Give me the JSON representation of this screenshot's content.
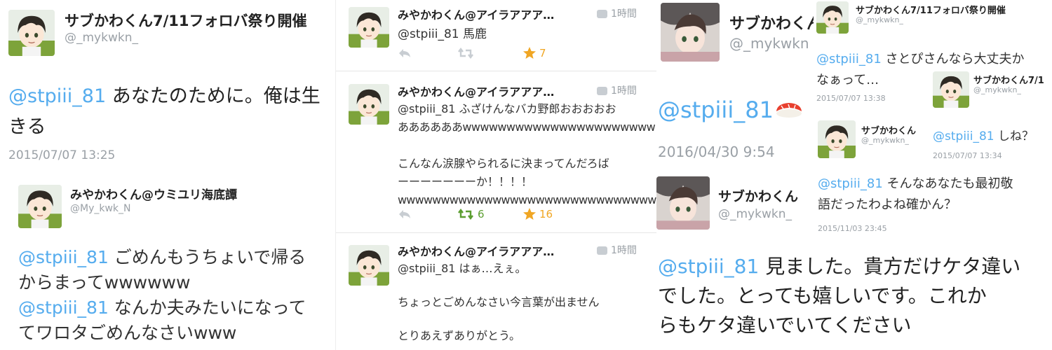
{
  "panel1": {
    "header": {
      "display_name": "サブかわくん7/11フォロバ祭り開催",
      "handle": "@_mykwkn_"
    },
    "tweet": {
      "mention": "@stpiii_81",
      "text_line1": " あなたのために。俺は生",
      "text_line2": "きる",
      "timestamp": "2015/07/07 13:25"
    },
    "reply": {
      "display_name": "みやかわくん@ウミユリ海底譚",
      "handle": "@My_kwk_N",
      "line1_mention": "@stpiii_81",
      "line1_text": " ごめんもうちょいで帰る",
      "line2": "からまってwwwwww",
      "line3_mention": "@stpiii_81",
      "line3_text": " なんか夫みたいになって",
      "line4": "てワロタごめんなさいwww"
    }
  },
  "panel2": {
    "tweets": [
      {
        "name": "みやかわくん@アイラアアア…",
        "time": "1時間",
        "mention": "@stpiii_81",
        "text": " 馬鹿",
        "retweets": "",
        "favorites": "7"
      },
      {
        "name": "みやかわくん@アイラアアア…",
        "time": "1時間",
        "mention": "@stpiii_81",
        "text_line1": " ふざけんなバカ野郎おおおおお",
        "text_line2": "ああああああwwwwwwwwwwwwwwwwwwwwww",
        "text_line3": "こんなん涙腺やられるに決まってんだろば",
        "text_line4": "ーーーーーーーか！！！！",
        "text_line5": "wwwwwwwwwwwwwwwwwwwwwwwwwwwwww",
        "retweets": "6",
        "favorites": "16"
      },
      {
        "name": "みやかわくん@アイラアアア…",
        "time": "1時間",
        "mention": "@stpiii_81",
        "text_line1": " はぁ…えぇ。",
        "text_line2": "ちょっとごめんなさい今言葉が出ません",
        "text_line3": "とりあえずありがとう。"
      }
    ]
  },
  "panel3": {
    "header": {
      "display_name": "サブかわくん",
      "handle": "@_mykwkn"
    },
    "tweet": {
      "mention": "@stpiii_81",
      "emoji": "sushi-icon",
      "timestamp": "2016/04/30 9:54"
    },
    "second": {
      "display_name": "サブかわくん",
      "handle": "@_mykwkn_"
    },
    "reply": {
      "mention": "@stpiii_81",
      "text_line1": " 見ました。貴方だけケタ違い",
      "text_line2": "でした。とっても嬉しいです。これか",
      "text_line3": "らもケタ違いでいてください"
    }
  },
  "panel4": {
    "tweet1": {
      "display_name": "サブかわくん7/11フォロバ祭り開催",
      "handle": "@_mykwkn_",
      "mention": "@stpiii_81",
      "text_line1": " さとぴさんなら大丈夫か",
      "text_line2": "なぁって…",
      "timestamp": "2015/07/07 13:38"
    },
    "tweet2": {
      "display_name": "サブかわくん7/1",
      "handle": "@_mykwkn_",
      "mention": "@stpiii_81",
      "text": " しね？",
      "timestamp": "2015/07/07 13:34"
    },
    "tweet3": {
      "display_name": "サブかわくん",
      "handle": "@_mykwkn_"
    },
    "tweet4": {
      "mention": "@stpiii_81",
      "text_line1": " そんなあなたも最初敬",
      "text_line2": "語だったわよね確かん？",
      "timestamp": "2015/11/03 23:45"
    }
  },
  "colors": {
    "mention": "#55acee",
    "retweet_active": "#5c9e31",
    "favorite": "#f0a624",
    "gray": "#9aa0a6"
  }
}
